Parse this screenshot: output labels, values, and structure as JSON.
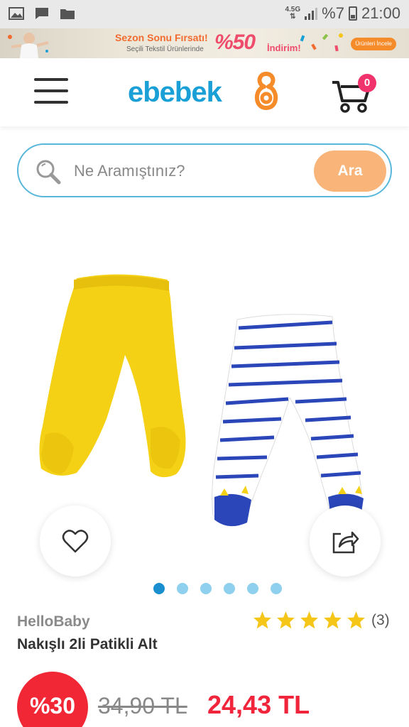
{
  "status_bar": {
    "network": "4.5G",
    "battery_percent": "%7",
    "time": "21:00"
  },
  "promo_banner": {
    "title": "Sezon Sonu Fırsatı!",
    "subtitle": "Seçili Tekstil Ürünlerinde",
    "discount_value": "%50",
    "discount_label": "İndirim!",
    "cta_label": "Ürünleri İncele"
  },
  "header": {
    "logo_text": "ebebek",
    "cart_count": "0"
  },
  "search": {
    "placeholder": "Ne Aramıştınız?",
    "button_label": "Ara"
  },
  "gallery": {
    "total_images": 6,
    "active_index": 0
  },
  "product": {
    "brand": "HelloBaby",
    "name": "Nakışlı 2li Patikli Alt",
    "rating_stars": 5,
    "review_count": "(3)",
    "discount_badge": "%30",
    "old_price": "34,90 TL",
    "new_price": "24,43 TL"
  },
  "colors": {
    "brand_blue": "#1aa0d6",
    "brand_orange": "#f68b2a",
    "price_red": "#f0243a",
    "star_yellow": "#f5c518"
  }
}
